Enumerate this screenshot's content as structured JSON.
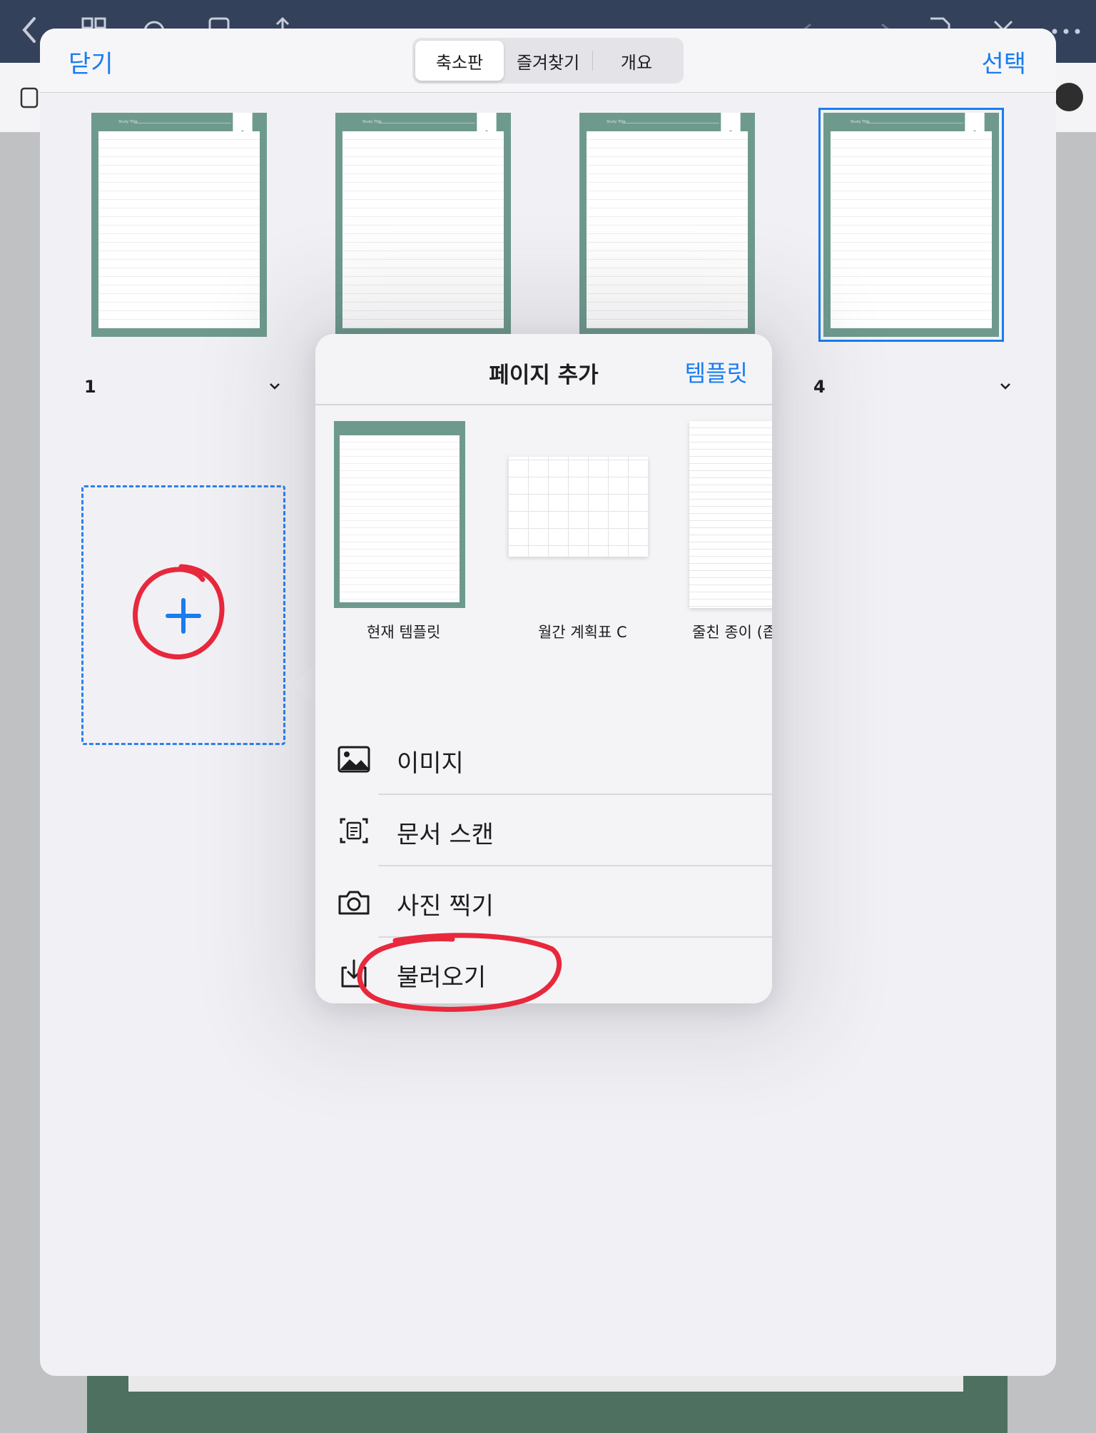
{
  "sheet": {
    "close_label": "닫기",
    "select_label": "선택",
    "segments": [
      "축소판",
      "즐겨찾기",
      "개요"
    ],
    "active_segment": "축소판"
  },
  "pages": [
    {
      "number": "1",
      "header_text": "Study Title"
    },
    {
      "number": "",
      "header_text": "Study Title"
    },
    {
      "number": "",
      "header_text": "Study Title"
    },
    {
      "number": "4",
      "header_text": "Study Title",
      "selected": true
    }
  ],
  "popover": {
    "title": "페이지 추가",
    "template_button": "템플릿",
    "templates": [
      {
        "label": "현재 템플릿"
      },
      {
        "label": "월간 계획표 C"
      },
      {
        "label": "줄친 종이 (좁"
      }
    ],
    "menu": [
      {
        "label": "이미지",
        "icon": "image-icon"
      },
      {
        "label": "문서 스캔",
        "icon": "document-scan-icon"
      },
      {
        "label": "사진 찍기",
        "icon": "camera-icon"
      },
      {
        "label": "불러오기",
        "icon": "import-icon"
      }
    ]
  },
  "colors": {
    "accent": "#1a7cf0",
    "page_green": "#6e9a8e",
    "annotation_red": "#e8283c",
    "topbar": "#34415a"
  }
}
